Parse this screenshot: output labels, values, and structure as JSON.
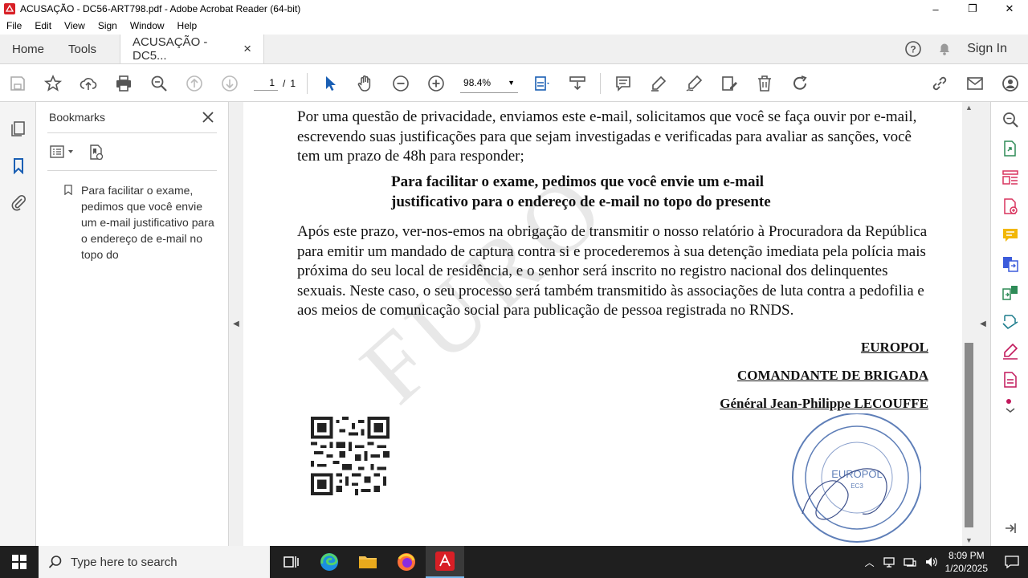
{
  "window": {
    "title": "ACUSAÇÃO - DC56-ART798.pdf - Adobe Acrobat Reader (64-bit)",
    "minimize": "–",
    "restore": "❐",
    "close": "✕"
  },
  "menu": [
    "File",
    "Edit",
    "View",
    "Sign",
    "Window",
    "Help"
  ],
  "tabs": {
    "home": "Home",
    "tools": "Tools",
    "doc": "ACUSAÇÃO - DC5...",
    "doc_close": "×",
    "sign_in": "Sign In"
  },
  "toolbar": {
    "page_current": "1",
    "page_sep": "/",
    "page_total": "1",
    "zoom": "98.4%"
  },
  "bookmarks": {
    "title": "Bookmarks",
    "item": "Para facilitar o exame, pedimos que você envie um e-mail justificativo para o endereço de e-mail no topo do"
  },
  "document": {
    "watermark": "FURO",
    "para1": "Por uma questão de privacidade, enviamos este e-mail, solicitamos que você se faça ouvir por e-mail, escrevendo suas justificações para que sejam investigadas e verificadas para avaliar as sanções, você tem um prazo de 48h para responder;",
    "bold": "Para facilitar o exame, pedimos que você envie um e-mail justificativo para o endereço de e-mail no topo do presente",
    "para2": "Após este prazo, ver-nos-emos na obrigação de transmitir o nosso relatório à Procuradora da República para emitir um mandado de captura contra si e procederemos à sua detenção imediata pela polícia mais próxima do seu local de residência, e o senhor será inscrito no registro nacional dos delinquentes sexuais. Neste caso, o seu processo será também transmitido às associações de luta contra a pedofilia e aos meios de comunicação social para publicação de pessoa registrada no RNDS.",
    "sig1": "EUROPOL",
    "sig2": "COMANDANTE DE BRIGADA",
    "sig3": "Général Jean-Philippe LECOUFFE"
  },
  "taskbar": {
    "search_placeholder": "Type here to search",
    "time": "8:09 PM",
    "date": "1/20/2025"
  }
}
